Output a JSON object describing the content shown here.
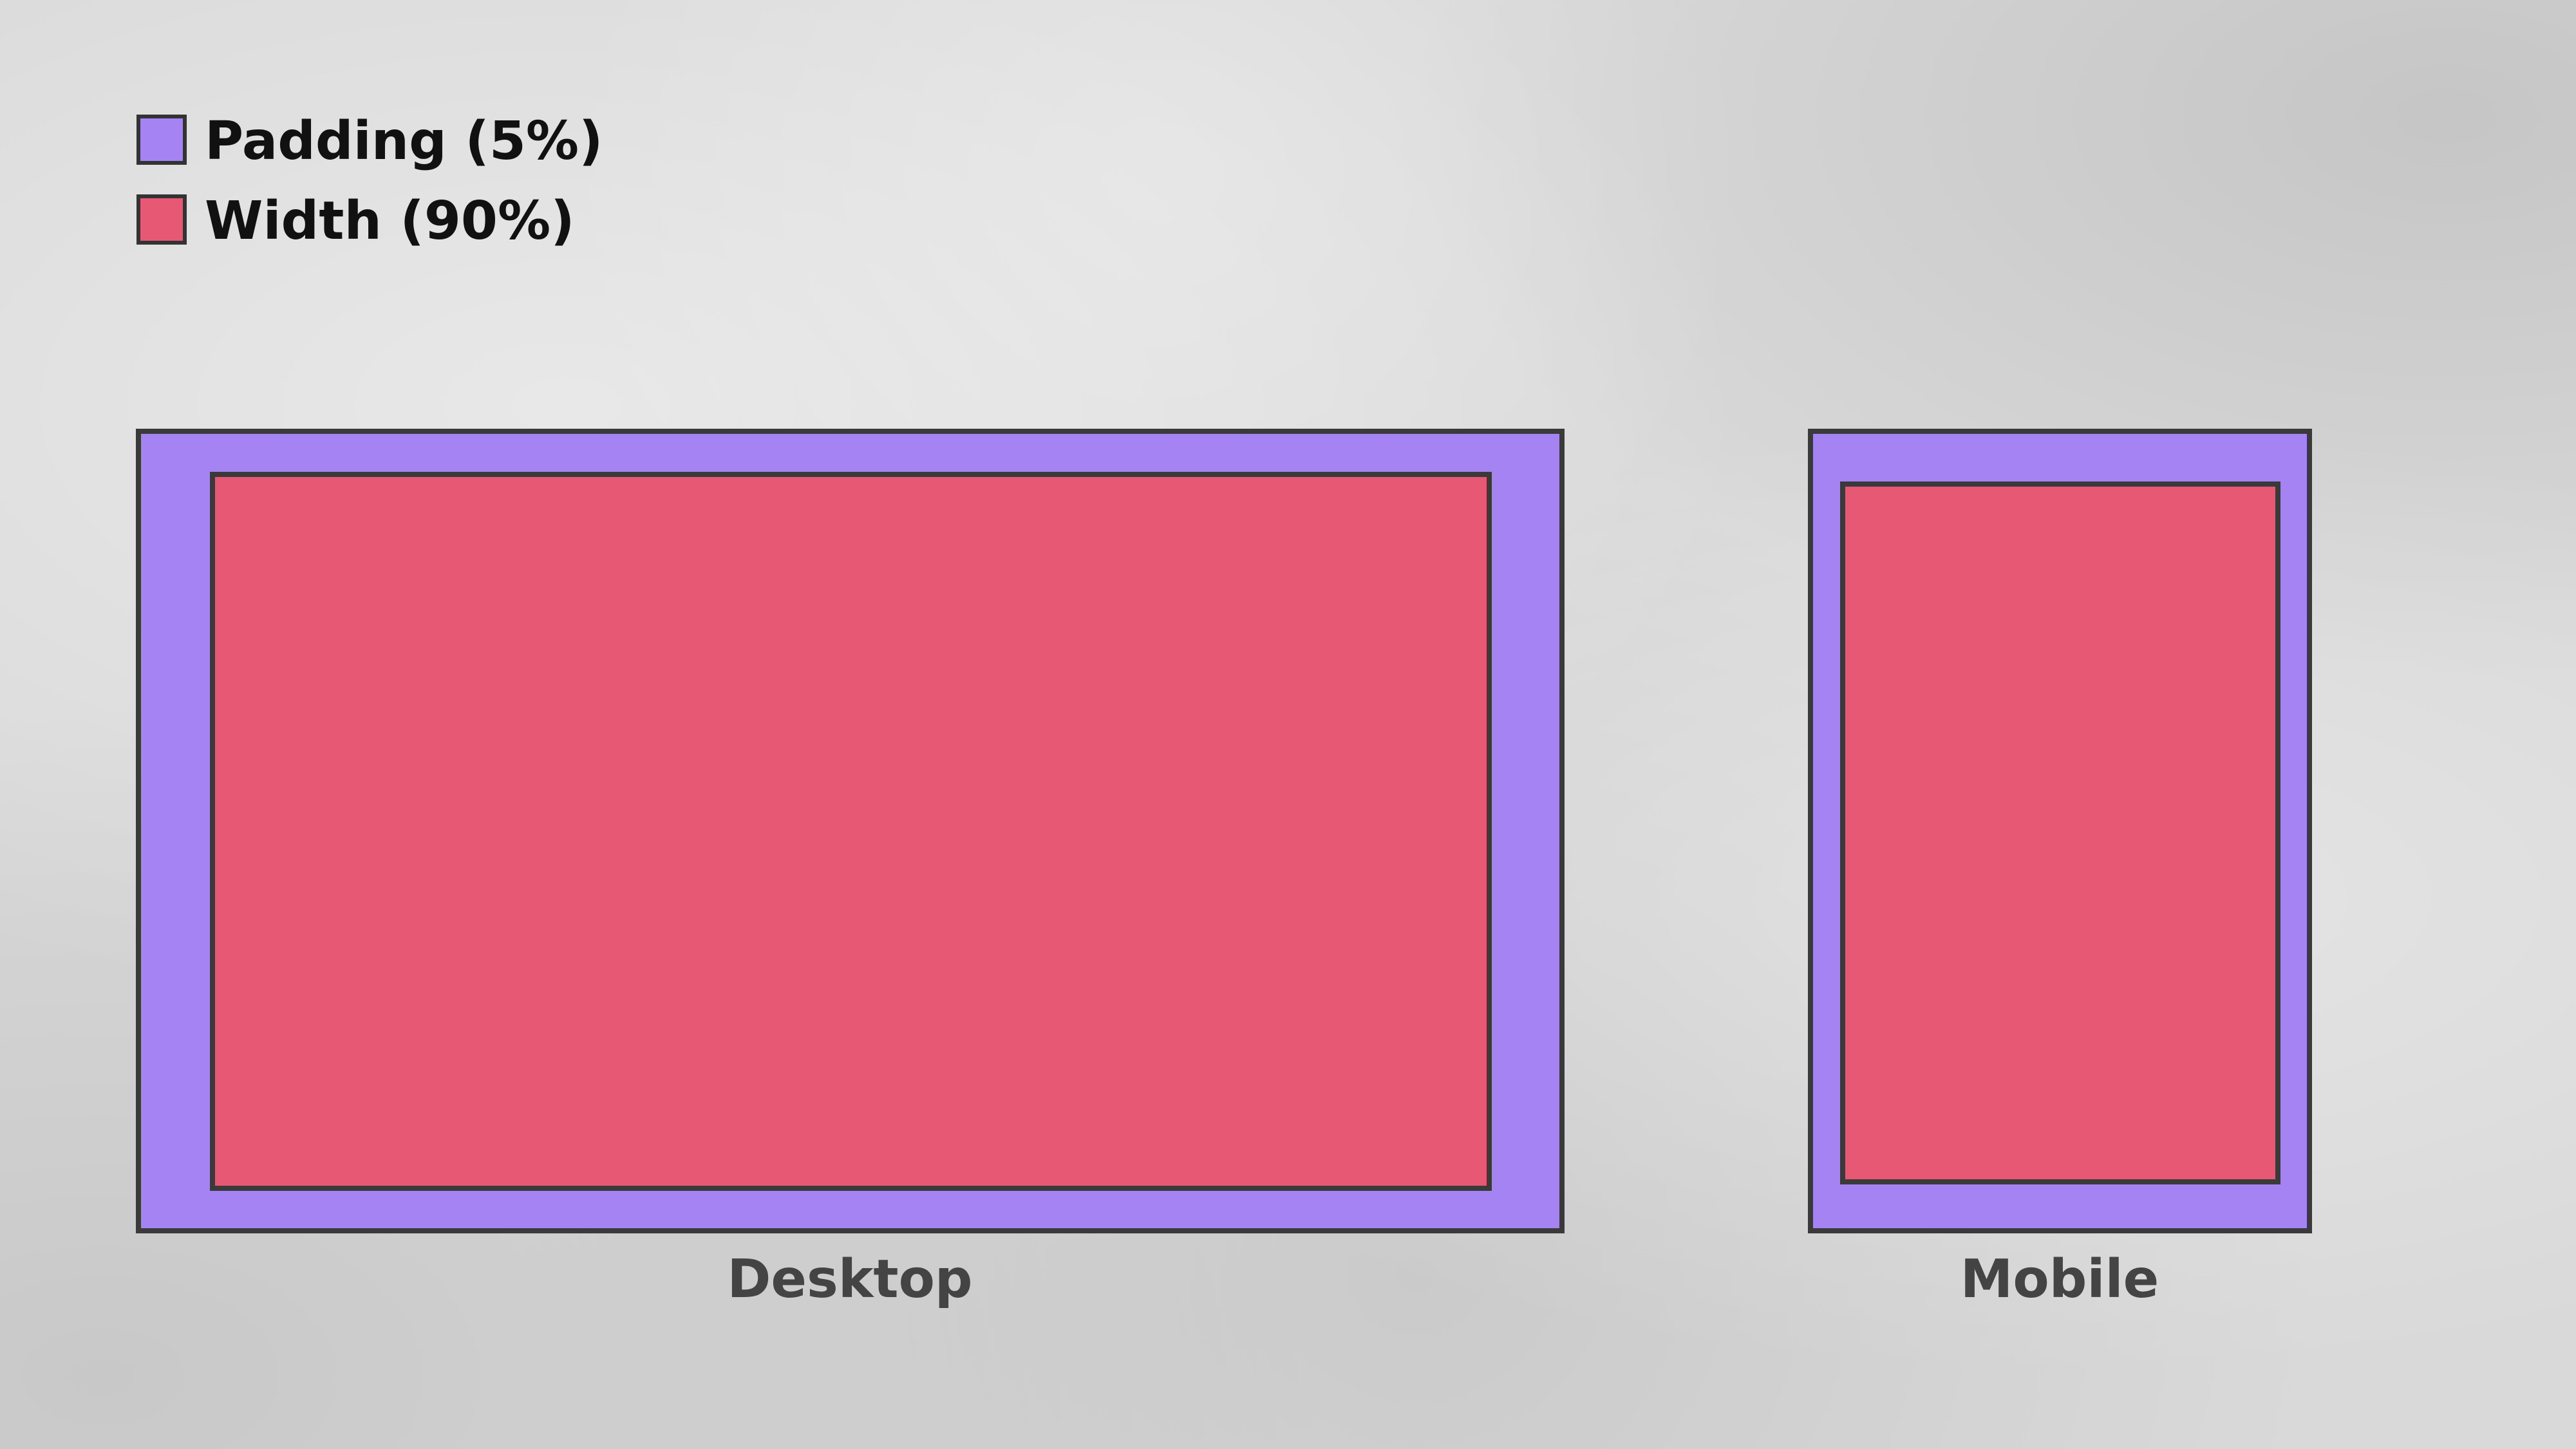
{
  "legend": {
    "items": [
      {
        "label": "Padding (5%)",
        "color": "#a583f3"
      },
      {
        "label": "Width (90%)",
        "color": "#e65874"
      }
    ]
  },
  "devices": [
    {
      "label": "Desktop",
      "padding_percent": 5,
      "width_percent": 90
    },
    {
      "label": "Mobile",
      "padding_percent": 5,
      "width_percent": 90
    }
  ],
  "colors": {
    "padding": "#a583f3",
    "content": "#e65874",
    "outline": "#3a3a3a",
    "background": "#d9d9d9"
  }
}
